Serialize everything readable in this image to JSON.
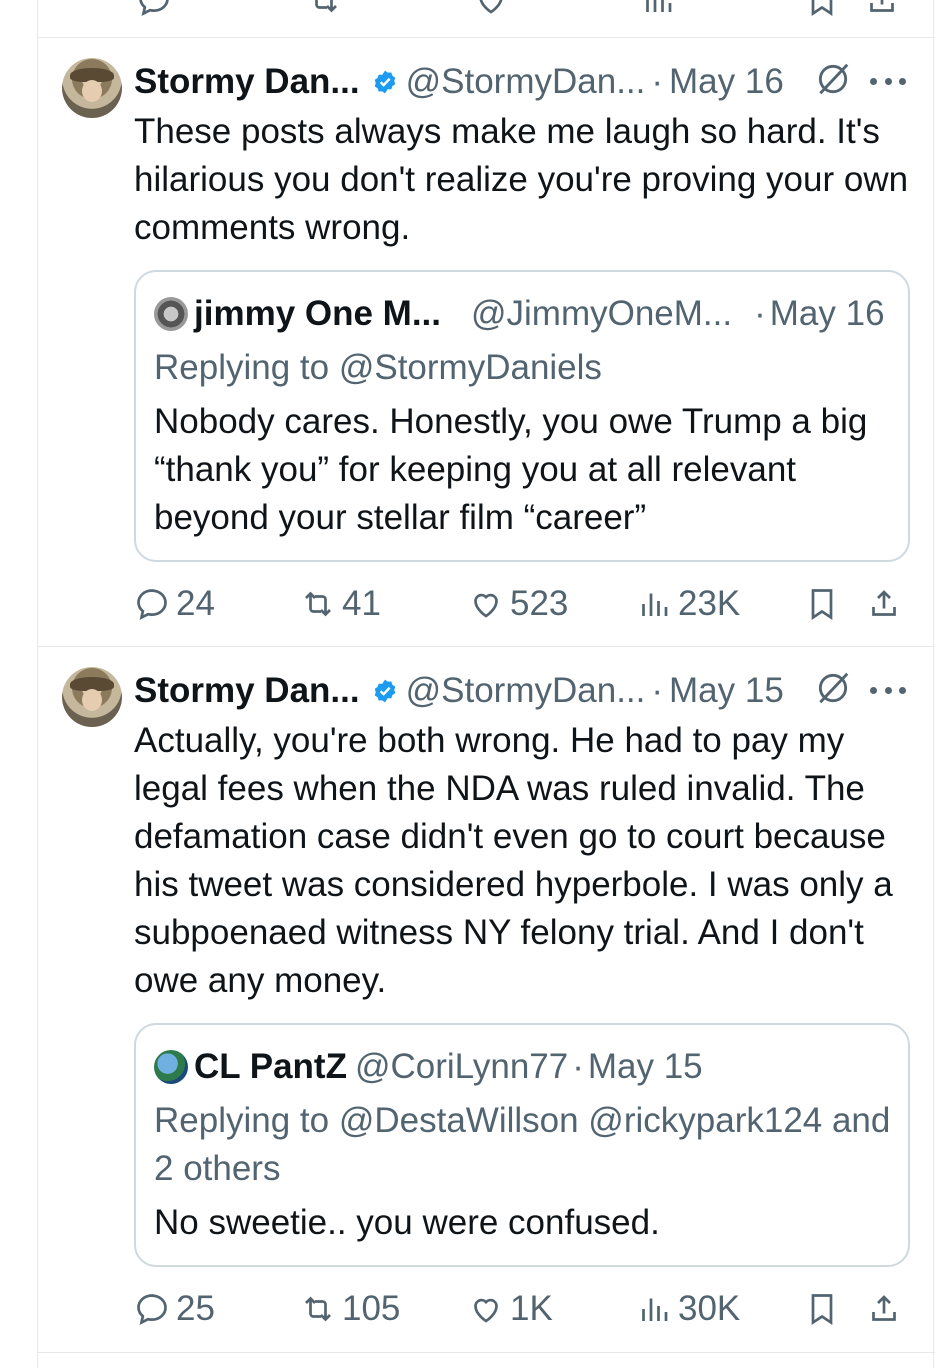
{
  "tweets": [
    {
      "author": {
        "name": "Stormy Dan...",
        "handle": "@StormyDan...",
        "verified": true
      },
      "separator": "·",
      "date": "May 16",
      "text": "These posts always make me laugh so hard. It's hilarious you don't realize you're proving your own comments wrong.",
      "quote": {
        "name": "jimmy One M...",
        "handle": "@JimmyOneM...",
        "separator": "·",
        "date": "May 16",
        "replying": "Replying to @StormyDaniels",
        "text": "Nobody cares. Honestly, you owe Trump a big “thank you” for keeping you at all relevant beyond your stellar film “career”"
      },
      "stats": {
        "replies": "24",
        "reposts": "41",
        "likes": "523",
        "views": "23K"
      }
    },
    {
      "author": {
        "name": "Stormy Dan...",
        "handle": "@StormyDan...",
        "verified": true
      },
      "separator": "·",
      "date": "May 15",
      "text": "Actually, you're both wrong. He had to pay my legal fees when the NDA was ruled invalid. The defamation case didn't even go to court because his tweet was considered hyperbole. I was only a subpoenaed witness NY felony trial. And I don't owe any money.",
      "quote": {
        "name": "CL PantZ",
        "handle": "@CoriLynn77",
        "separator": "·",
        "date": "May 15",
        "replying": "Replying to @DestaWillson @rickypark124 and 2 others",
        "text": "No sweetie.. you were confused."
      },
      "stats": {
        "replies": "25",
        "reposts": "105",
        "likes": "1K",
        "views": "30K"
      }
    }
  ],
  "colors": {
    "secondary": "#536471",
    "verified": "#1d9bf0",
    "border": "#e6e9eb",
    "quote_border": "#cfd9de"
  },
  "icons": [
    "reply-icon",
    "repost-icon",
    "like-icon",
    "views-icon",
    "bookmark-icon",
    "share-icon",
    "verified-badge-icon",
    "grok-icon",
    "more-icon"
  ]
}
